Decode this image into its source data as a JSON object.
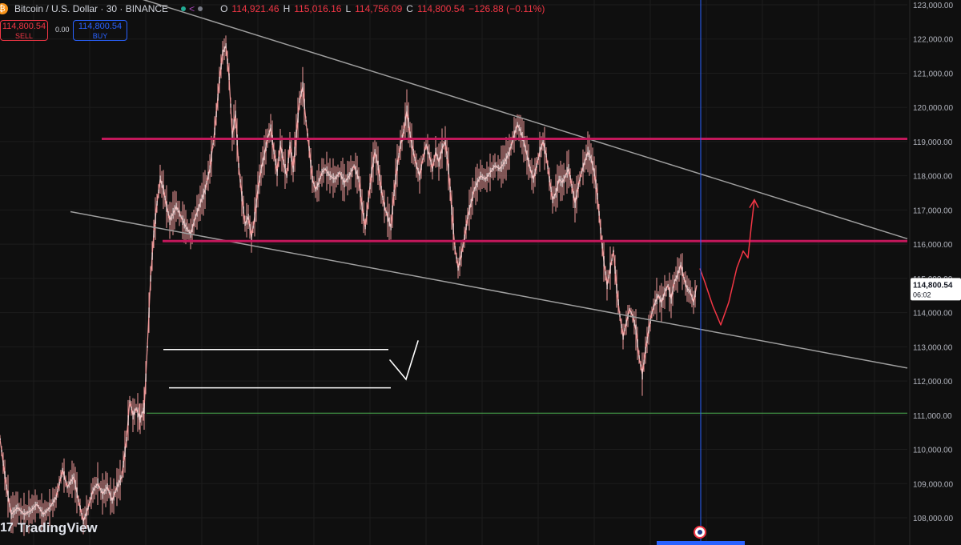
{
  "header": {
    "symbol_icon": "bitcoin-icon",
    "title": "Bitcoin / U.S. Dollar · 30 · BINANCE",
    "ohlc": [
      {
        "k": "O",
        "v": "114,921.46"
      },
      {
        "k": "H",
        "v": "115,016.16"
      },
      {
        "k": "L",
        "v": "114,756.09"
      },
      {
        "k": "C",
        "v": "114,800.54"
      }
    ],
    "change": "−126.88 (−0.11%)"
  },
  "trade": {
    "sell_price": "114,800.54",
    "sell_label": "SELL",
    "spread": "0.00",
    "buy_price": "114,800.54",
    "buy_label": "BUY"
  },
  "watermark": {
    "logo_text": "17",
    "brand": "TradingView"
  },
  "colors": {
    "background": "#0f0f0f",
    "candle": "#ef9a9a",
    "candle_body": "#f5d5d5",
    "resistance_line": "#c2185b",
    "trend_line": "#9e9e9e",
    "green_line": "#4caf50",
    "projection": "#f23645",
    "crosshair": "#2962ff",
    "price_label_bg": "#ffffff"
  },
  "chart_data": {
    "type": "line",
    "title": "Bitcoin / U.S. Dollar · 30 · BINANCE",
    "ylim": [
      107600,
      123200
    ],
    "y_ticks": [
      "123,000.00",
      "122,000.00",
      "121,000.00",
      "120,000.00",
      "119,000.00",
      "118,000.00",
      "117,000.00",
      "116,000.00",
      "115,000.00",
      "114,000.00",
      "113,000.00",
      "112,000.00",
      "111,000.00",
      "110,000.00",
      "109,000.00",
      "108,000.00"
    ],
    "current_price_label": "114,800.54",
    "countdown_label": "06:02",
    "current_price": 114800.54,
    "price_series": [
      {
        "i": 0,
        "v": 110300
      },
      {
        "i": 8,
        "v": 108900
      },
      {
        "i": 14,
        "v": 108100
      },
      {
        "i": 22,
        "v": 108300
      },
      {
        "i": 30,
        "v": 108100
      },
      {
        "i": 38,
        "v": 108200
      },
      {
        "i": 46,
        "v": 108400
      },
      {
        "i": 54,
        "v": 108100
      },
      {
        "i": 62,
        "v": 108300
      },
      {
        "i": 70,
        "v": 108600
      },
      {
        "i": 78,
        "v": 109400
      },
      {
        "i": 84,
        "v": 108900
      },
      {
        "i": 92,
        "v": 109200
      },
      {
        "i": 98,
        "v": 108500
      },
      {
        "i": 104,
        "v": 107900
      },
      {
        "i": 110,
        "v": 108300
      },
      {
        "i": 116,
        "v": 108800
      },
      {
        "i": 122,
        "v": 109000
      },
      {
        "i": 128,
        "v": 108700
      },
      {
        "i": 134,
        "v": 108900
      },
      {
        "i": 140,
        "v": 108500
      },
      {
        "i": 146,
        "v": 108900
      },
      {
        "i": 152,
        "v": 109200
      },
      {
        "i": 158,
        "v": 110300
      },
      {
        "i": 162,
        "v": 111400
      },
      {
        "i": 166,
        "v": 111000
      },
      {
        "i": 170,
        "v": 111200
      },
      {
        "i": 175,
        "v": 110900
      },
      {
        "i": 180,
        "v": 111200
      },
      {
        "i": 184,
        "v": 113000
      },
      {
        "i": 188,
        "v": 115000
      },
      {
        "i": 192,
        "v": 116300
      },
      {
        "i": 196,
        "v": 117200
      },
      {
        "i": 200,
        "v": 117900
      },
      {
        "i": 204,
        "v": 117600
      },
      {
        "i": 208,
        "v": 117100
      },
      {
        "i": 212,
        "v": 116700
      },
      {
        "i": 216,
        "v": 116900
      },
      {
        "i": 220,
        "v": 117100
      },
      {
        "i": 226,
        "v": 116800
      },
      {
        "i": 232,
        "v": 116500
      },
      {
        "i": 238,
        "v": 116300
      },
      {
        "i": 244,
        "v": 116800
      },
      {
        "i": 250,
        "v": 117200
      },
      {
        "i": 256,
        "v": 117600
      },
      {
        "i": 262,
        "v": 118200
      },
      {
        "i": 268,
        "v": 119300
      },
      {
        "i": 274,
        "v": 120800
      },
      {
        "i": 278,
        "v": 121600
      },
      {
        "i": 282,
        "v": 121800
      },
      {
        "i": 286,
        "v": 120900
      },
      {
        "i": 290,
        "v": 119200
      },
      {
        "i": 294,
        "v": 119800
      },
      {
        "i": 298,
        "v": 118300
      },
      {
        "i": 302,
        "v": 117400
      },
      {
        "i": 306,
        "v": 116600
      },
      {
        "i": 310,
        "v": 116800
      },
      {
        "i": 314,
        "v": 116200
      },
      {
        "i": 318,
        "v": 116800
      },
      {
        "i": 322,
        "v": 117600
      },
      {
        "i": 326,
        "v": 118200
      },
      {
        "i": 330,
        "v": 118600
      },
      {
        "i": 334,
        "v": 119100
      },
      {
        "i": 338,
        "v": 119400
      },
      {
        "i": 342,
        "v": 118700
      },
      {
        "i": 346,
        "v": 118100
      },
      {
        "i": 350,
        "v": 118900
      },
      {
        "i": 354,
        "v": 118400
      },
      {
        "i": 358,
        "v": 118000
      },
      {
        "i": 362,
        "v": 118900
      },
      {
        "i": 366,
        "v": 118200
      },
      {
        "i": 370,
        "v": 119200
      },
      {
        "i": 374,
        "v": 120200
      },
      {
        "i": 378,
        "v": 120600
      },
      {
        "i": 382,
        "v": 119600
      },
      {
        "i": 386,
        "v": 118800
      },
      {
        "i": 390,
        "v": 117900
      },
      {
        "i": 394,
        "v": 117600
      },
      {
        "i": 398,
        "v": 117800
      },
      {
        "i": 402,
        "v": 118100
      },
      {
        "i": 406,
        "v": 118200
      },
      {
        "i": 412,
        "v": 118000
      },
      {
        "i": 418,
        "v": 117900
      },
      {
        "i": 424,
        "v": 118100
      },
      {
        "i": 430,
        "v": 117800
      },
      {
        "i": 436,
        "v": 118000
      },
      {
        "i": 442,
        "v": 118300
      },
      {
        "i": 448,
        "v": 117900
      },
      {
        "i": 452,
        "v": 117100
      },
      {
        "i": 456,
        "v": 116500
      },
      {
        "i": 460,
        "v": 117300
      },
      {
        "i": 464,
        "v": 118100
      },
      {
        "i": 468,
        "v": 118700
      },
      {
        "i": 472,
        "v": 118300
      },
      {
        "i": 476,
        "v": 117600
      },
      {
        "i": 480,
        "v": 117100
      },
      {
        "i": 484,
        "v": 116800
      },
      {
        "i": 488,
        "v": 116500
      },
      {
        "i": 492,
        "v": 117500
      },
      {
        "i": 496,
        "v": 118300
      },
      {
        "i": 500,
        "v": 118900
      },
      {
        "i": 504,
        "v": 119300
      },
      {
        "i": 508,
        "v": 119900
      },
      {
        "i": 512,
        "v": 119200
      },
      {
        "i": 516,
        "v": 118700
      },
      {
        "i": 520,
        "v": 118300
      },
      {
        "i": 524,
        "v": 118000
      },
      {
        "i": 528,
        "v": 118500
      },
      {
        "i": 532,
        "v": 118900
      },
      {
        "i": 536,
        "v": 118600
      },
      {
        "i": 540,
        "v": 118200
      },
      {
        "i": 544,
        "v": 118700
      },
      {
        "i": 548,
        "v": 118400
      },
      {
        "i": 552,
        "v": 118800
      },
      {
        "i": 556,
        "v": 119000
      },
      {
        "i": 560,
        "v": 118200
      },
      {
        "i": 564,
        "v": 117000
      },
      {
        "i": 568,
        "v": 115900
      },
      {
        "i": 572,
        "v": 115300
      },
      {
        "i": 576,
        "v": 115700
      },
      {
        "i": 580,
        "v": 116200
      },
      {
        "i": 584,
        "v": 116800
      },
      {
        "i": 588,
        "v": 117200
      },
      {
        "i": 592,
        "v": 117600
      },
      {
        "i": 596,
        "v": 117800
      },
      {
        "i": 600,
        "v": 118000
      },
      {
        "i": 606,
        "v": 117900
      },
      {
        "i": 612,
        "v": 118100
      },
      {
        "i": 618,
        "v": 118300
      },
      {
        "i": 624,
        "v": 118200
      },
      {
        "i": 630,
        "v": 118400
      },
      {
        "i": 636,
        "v": 118700
      },
      {
        "i": 642,
        "v": 119200
      },
      {
        "i": 646,
        "v": 119500
      },
      {
        "i": 650,
        "v": 119300
      },
      {
        "i": 654,
        "v": 119000
      },
      {
        "i": 658,
        "v": 118600
      },
      {
        "i": 662,
        "v": 118200
      },
      {
        "i": 666,
        "v": 117900
      },
      {
        "i": 670,
        "v": 118300
      },
      {
        "i": 674,
        "v": 118700
      },
      {
        "i": 678,
        "v": 119000
      },
      {
        "i": 682,
        "v": 118600
      },
      {
        "i": 686,
        "v": 117900
      },
      {
        "i": 690,
        "v": 117300
      },
      {
        "i": 694,
        "v": 117500
      },
      {
        "i": 698,
        "v": 117900
      },
      {
        "i": 702,
        "v": 117800
      },
      {
        "i": 706,
        "v": 118000
      },
      {
        "i": 710,
        "v": 118200
      },
      {
        "i": 714,
        "v": 117700
      },
      {
        "i": 718,
        "v": 117200
      },
      {
        "i": 722,
        "v": 117700
      },
      {
        "i": 726,
        "v": 118100
      },
      {
        "i": 730,
        "v": 118400
      },
      {
        "i": 734,
        "v": 118700
      },
      {
        "i": 738,
        "v": 118500
      },
      {
        "i": 742,
        "v": 118100
      },
      {
        "i": 746,
        "v": 117400
      },
      {
        "i": 750,
        "v": 116400
      },
      {
        "i": 754,
        "v": 115500
      },
      {
        "i": 758,
        "v": 114800
      },
      {
        "i": 762,
        "v": 115300
      },
      {
        "i": 766,
        "v": 115800
      },
      {
        "i": 770,
        "v": 114700
      },
      {
        "i": 774,
        "v": 113900
      },
      {
        "i": 778,
        "v": 113300
      },
      {
        "i": 782,
        "v": 113700
      },
      {
        "i": 786,
        "v": 114100
      },
      {
        "i": 790,
        "v": 113900
      },
      {
        "i": 794,
        "v": 113500
      },
      {
        "i": 798,
        "v": 112700
      },
      {
        "i": 802,
        "v": 112200
      },
      {
        "i": 806,
        "v": 112900
      },
      {
        "i": 810,
        "v": 113500
      },
      {
        "i": 814,
        "v": 114000
      },
      {
        "i": 818,
        "v": 114300
      },
      {
        "i": 822,
        "v": 114500
      },
      {
        "i": 826,
        "v": 114300
      },
      {
        "i": 830,
        "v": 114600
      },
      {
        "i": 834,
        "v": 114800
      },
      {
        "i": 838,
        "v": 114400
      },
      {
        "i": 842,
        "v": 114900
      },
      {
        "i": 846,
        "v": 115100
      },
      {
        "i": 850,
        "v": 115400
      },
      {
        "i": 854,
        "v": 115000
      },
      {
        "i": 858,
        "v": 114700
      },
      {
        "i": 862,
        "v": 114600
      },
      {
        "i": 866,
        "v": 114300
      },
      {
        "i": 870,
        "v": 114800
      }
    ],
    "horizontal_levels": [
      {
        "name": "upper-resistance",
        "value": 119080,
        "x_start": 127
      },
      {
        "name": "lower-support",
        "value": 116090,
        "x_start": 203
      },
      {
        "name": "green-level",
        "value": 111060,
        "x_start": 183
      }
    ],
    "trend_lines": [
      {
        "name": "upper-trendline",
        "points": [
          [
            145,
            123400
          ],
          [
            1133,
            116160
          ]
        ]
      },
      {
        "name": "lower-trendline",
        "points": [
          [
            88,
            116950
          ],
          [
            1133,
            112380
          ]
        ]
      }
    ],
    "annotations": {
      "white_lines": [
        {
          "x1": 204,
          "x2": 485,
          "v": 112920
        },
        {
          "x1": 211,
          "x2": 488,
          "v": 111800
        }
      ],
      "checkmark": true,
      "projection_path": [
        [
          874,
          115290
        ],
        [
          880,
          114900
        ],
        [
          890,
          114200
        ],
        [
          900,
          113640
        ],
        [
          910,
          114300
        ],
        [
          920,
          115300
        ],
        [
          928,
          115800
        ],
        [
          934,
          115600
        ],
        [
          938,
          116500
        ],
        [
          942,
          117300
        ]
      ]
    },
    "crosshair_x": 875
  }
}
